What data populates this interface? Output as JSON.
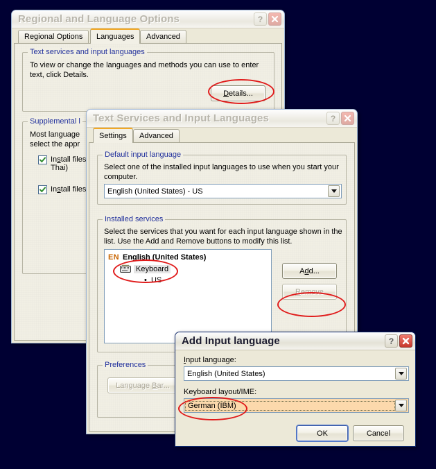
{
  "desktop": {
    "background_color": "#000033"
  },
  "annotation": {
    "color": "#e01b1b",
    "shape": "ellipse"
  },
  "dialogs": {
    "regional": {
      "title": "Regional and Language Options",
      "state": "inactive",
      "help_button": "?",
      "close_button": "close-icon",
      "tabs": [
        {
          "label": "Regional Options",
          "selected": false
        },
        {
          "label": "Languages",
          "selected": true
        },
        {
          "label": "Advanced",
          "selected": false
        }
      ],
      "text_services_group": {
        "label": "Text services and input languages",
        "description_line1": "To view or change the languages and methods you can use to enter",
        "description_line2": "text, click Details.",
        "details_button": "Details..."
      },
      "supplemental_group": {
        "label": "Supplemental l",
        "description_line1": "Most language",
        "description_line2": "select the appr",
        "checkbox1_line1": "Install files",
        "checkbox1_line2": "Thai)",
        "checkbox2_line1": "Install files"
      }
    },
    "text_services": {
      "title": "Text Services and Input Languages",
      "state": "inactive",
      "help_button": "?",
      "close_button": "close-icon",
      "tabs": [
        {
          "label": "Settings",
          "selected": true
        },
        {
          "label": "Advanced",
          "selected": false
        }
      ],
      "default_input_group": {
        "label": "Default input language",
        "description_line1": "Select one of the installed input languages to use when you start your",
        "description_line2": "computer.",
        "combo_value": "English (United States) - US"
      },
      "installed_services_group": {
        "label": "Installed services",
        "description_line1": "Select the services that you want for each input language shown in the",
        "description_line2": "list. Use the Add and Remove buttons to modify this list.",
        "tree": {
          "lang_badge": "EN",
          "lang_name": "English (United States)",
          "service_icon": "keyboard-icon",
          "service_label": "Keyboard",
          "layout_bullet": "•",
          "layout_label": "US"
        },
        "add_button": "Add...",
        "remove_button": "Remove"
      },
      "preferences_group": {
        "label": "Preferences",
        "language_bar_button": "Language Bar..."
      }
    },
    "add_input": {
      "title": "Add Input language",
      "state": "active",
      "help_button": "?",
      "close_button": "close-icon",
      "input_language_label": "Input language:",
      "input_language_value": "English (United States)",
      "keyboard_layout_label": "Keyboard layout/IME:",
      "keyboard_layout_value": "German (IBM)",
      "keyboard_layout_highlight": "#fcd9ac",
      "ok_button": "OK",
      "cancel_button": "Cancel"
    }
  }
}
